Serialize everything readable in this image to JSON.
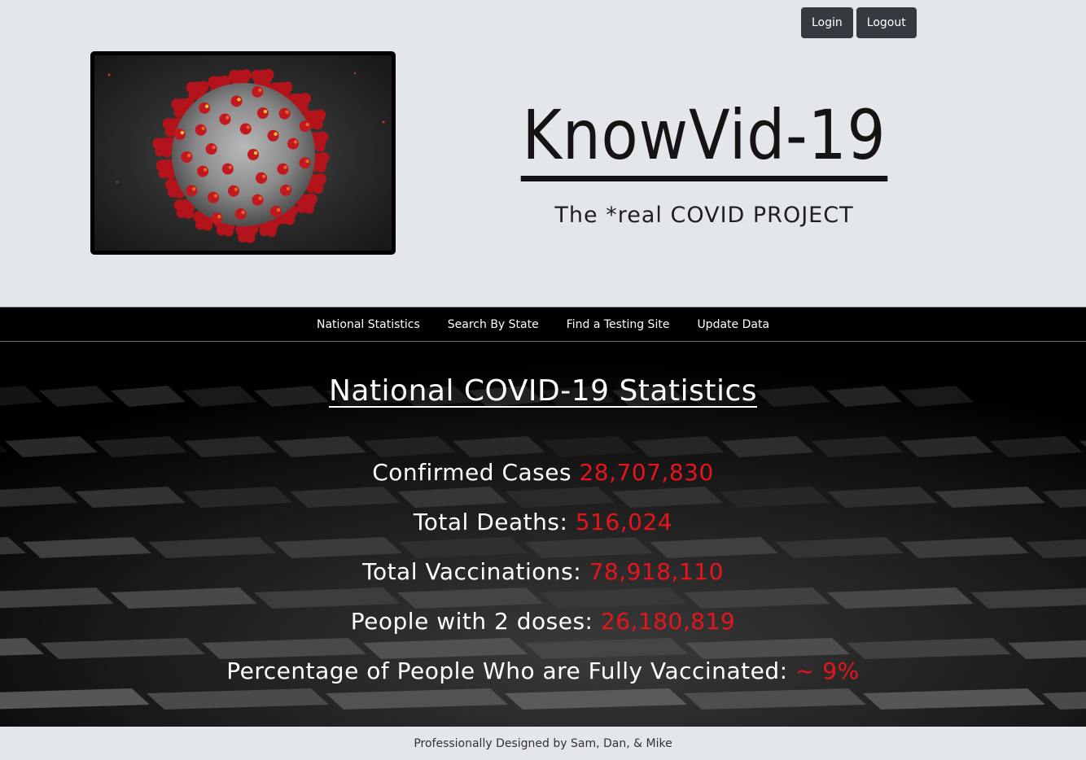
{
  "header": {
    "login_label": "Login",
    "logout_label": "Logout",
    "brand_title": "KnowVid-19",
    "brand_subtitle": "The *real COVID PROJECT"
  },
  "nav": {
    "items": [
      {
        "label": "National Statistics"
      },
      {
        "label": "Search By State"
      },
      {
        "label": "Find a Testing Site"
      },
      {
        "label": "Update Data"
      }
    ]
  },
  "stats": {
    "title": "National COVID-19 Statistics",
    "rows": [
      {
        "label": "Confirmed Cases",
        "value": "28,707,830"
      },
      {
        "label": "Total Deaths:",
        "value": "516,024"
      },
      {
        "label": "Total Vaccinations:",
        "value": "78,918,110"
      },
      {
        "label": "People with 2 doses:",
        "value": "26,180,819"
      },
      {
        "label": "Percentage of People Who are Fully Vaccinated:",
        "value": "~ 9%"
      }
    ]
  },
  "footer": {
    "text": "Professionally Designed by Sam, Dan, & Mike"
  },
  "colors": {
    "page_bg": "#e3e6ea",
    "nav_bg": "#000000",
    "button_bg": "#343a40",
    "stat_value": "#e8141c"
  },
  "icons": {
    "hero_image": "coronavirus-illustration"
  }
}
